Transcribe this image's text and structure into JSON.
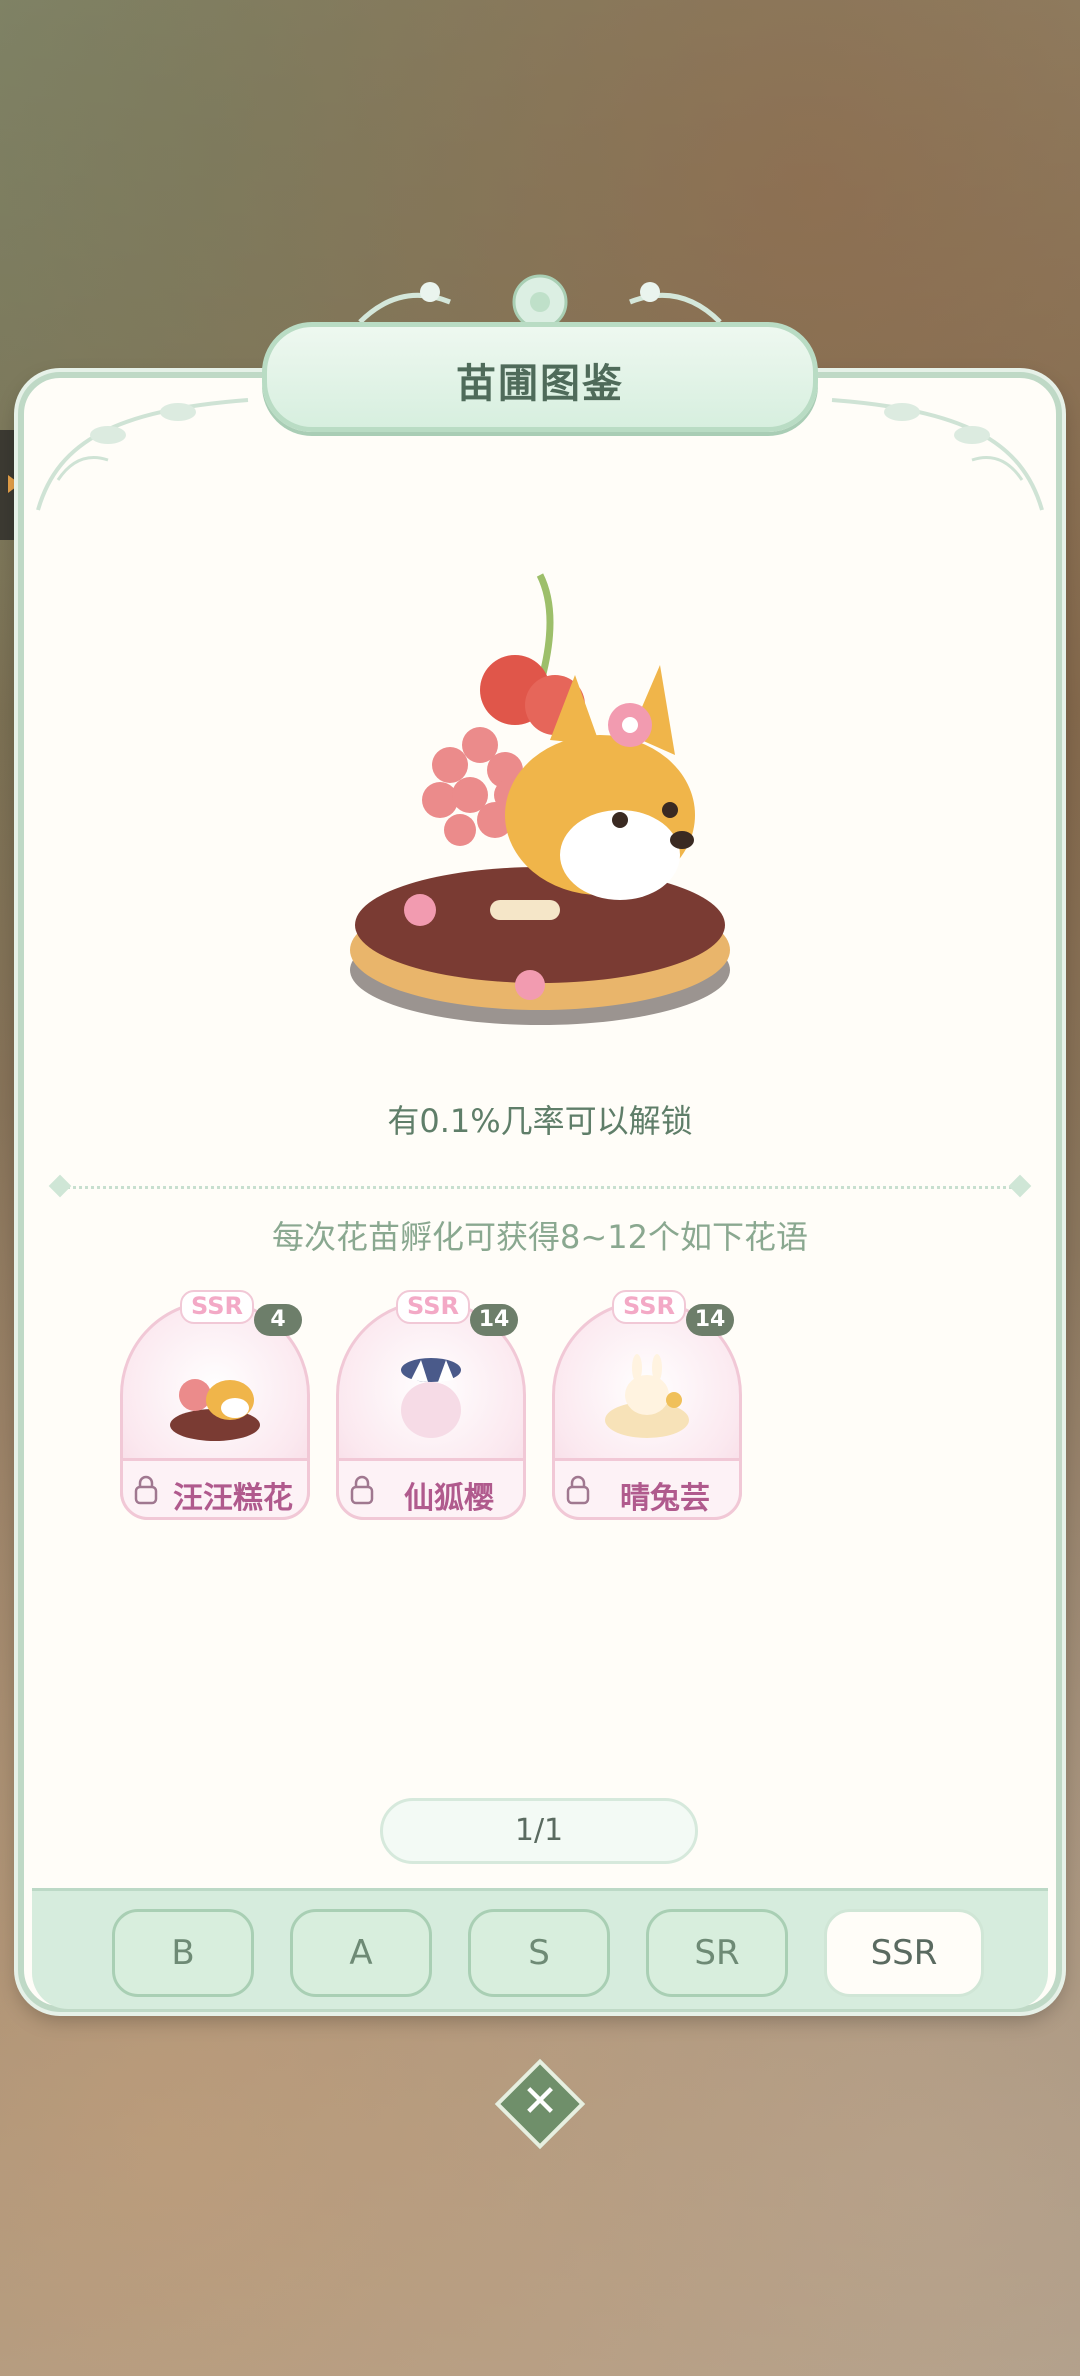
{
  "dialog": {
    "title": "苗圃图鉴",
    "unlock_text": "有0.1%几率可以解锁",
    "subtitle": "每次花苗孵化可获得8~12个如下花语"
  },
  "cards": [
    {
      "rarity": "SSR",
      "count": "4",
      "name": "汪汪糕花"
    },
    {
      "rarity": "SSR",
      "count": "14",
      "name": "仙狐樱"
    },
    {
      "rarity": "SSR",
      "count": "14",
      "name": "晴兔芸"
    }
  ],
  "pager": {
    "text": "1/1"
  },
  "tabs": [
    {
      "label": "B"
    },
    {
      "label": "A"
    },
    {
      "label": "S"
    },
    {
      "label": "SR"
    },
    {
      "label": "SSR",
      "active": true
    }
  ],
  "colors": {
    "panel_bg": "#fffdf8",
    "accent_green": "#bfd9c6",
    "ssr_pink": "#f3a9c6",
    "name_purple": "#b05a8d"
  },
  "icons": {
    "close": "close-icon",
    "lock": "lock-icon",
    "side_arrow": "arrow-right-icon"
  }
}
